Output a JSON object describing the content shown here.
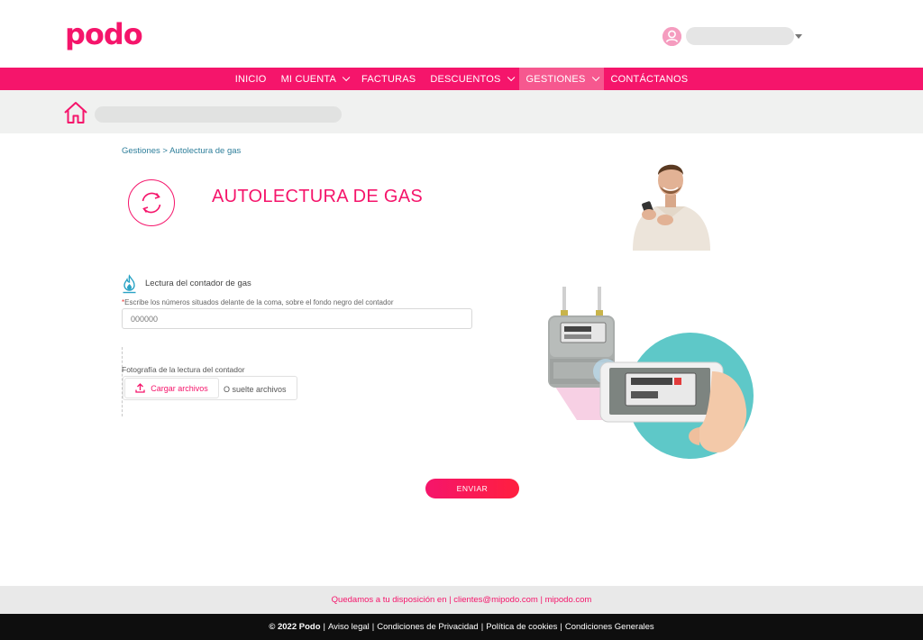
{
  "brand": {
    "logo_text": "podo",
    "accent": "#f5156b"
  },
  "nav": {
    "items": [
      {
        "label": "INICIO",
        "dropdown": false,
        "active": false
      },
      {
        "label": "MI CUENTA",
        "dropdown": true,
        "active": false
      },
      {
        "label": "FACTURAS",
        "dropdown": false,
        "active": false
      },
      {
        "label": "DESCUENTOS",
        "dropdown": true,
        "active": false
      },
      {
        "label": "GESTIONES",
        "dropdown": true,
        "active": true
      },
      {
        "label": "CONTÁCTANOS",
        "dropdown": false,
        "active": false
      }
    ]
  },
  "breadcrumb": "Gestiones > Autolectura de gas",
  "page": {
    "title": "AUTOLECTURA DE GAS",
    "reading_label": "Lectura del contador de gas",
    "hint_required": "*",
    "hint": "Escribe los números situados delante de la coma, sobre el fondo negro del contador",
    "reading_placeholder": "000000",
    "photo_label": "Fotografía de la lectura del contador",
    "upload_label": "Cargar archivos",
    "drop_text": "O suelte archivos",
    "submit_label": "ENVIAR"
  },
  "footer": {
    "contact_line": "Quedamos a tu disposición en | clientes@mipodo.com | mipodo.com",
    "copyright": "© 2022 Podo",
    "links": [
      "Aviso legal",
      "Condiciones de Privacidad",
      "Política de cookies",
      "Condiciones Generales"
    ]
  },
  "icons": {
    "user": "user-avatar-icon",
    "home": "home-icon",
    "refresh": "refresh-icon",
    "gas": "gas-flame-icon",
    "upload": "upload-icon"
  }
}
